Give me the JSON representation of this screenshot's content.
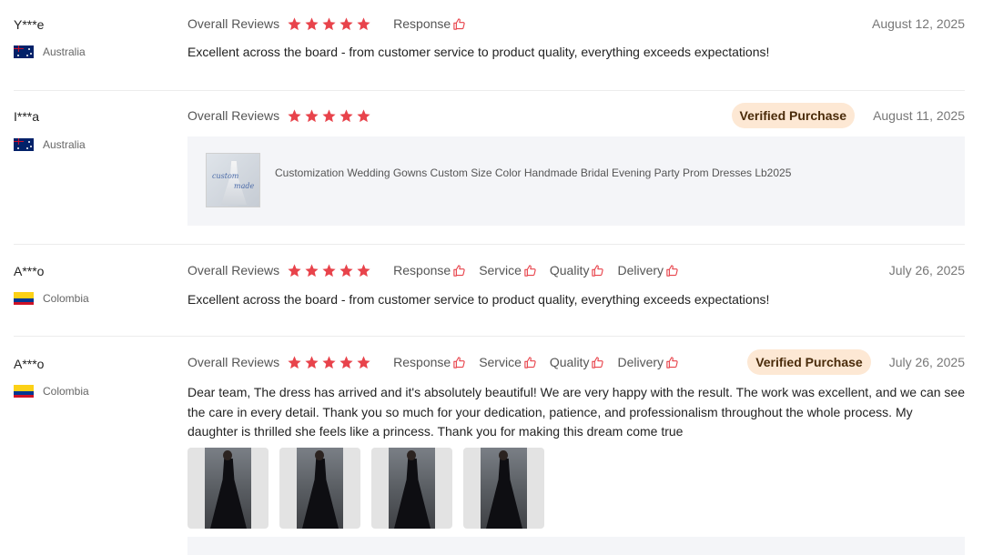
{
  "overall_label": "Overall Reviews",
  "verified_label": "Verified Purchase",
  "metrics": {
    "response": "Response",
    "service": "Service",
    "quality": "Quality",
    "delivery": "Delivery"
  },
  "colors": {
    "star": "#e8434b",
    "thumb": "#e8434b",
    "badge_bg": "#fde8d4"
  },
  "reviews": [
    {
      "user": "Y***e",
      "country": "Australia",
      "rating": 5,
      "date": "August 12, 2025",
      "text": "Excellent across the board - from customer service to product quality, everything exceeds expectations!"
    },
    {
      "user": "I***a",
      "country": "Australia",
      "rating": 5,
      "date": "August 11, 2025",
      "product": {
        "title": "Customization Wedding Gowns Custom Size Color Handmade Bridal Evening Party Prom Dresses Lb2025",
        "thumb_watermark": [
          "custom",
          "made"
        ]
      }
    },
    {
      "user": "A***o",
      "country": "Colombia",
      "rating": 5,
      "date": "July 26, 2025",
      "text": "Excellent across the board - from customer service to product quality, everything exceeds expectations!"
    },
    {
      "user": "A***o",
      "country": "Colombia",
      "rating": 5,
      "date": "July 26, 2025",
      "text": "Dear team, The dress has arrived and it's absolutely beautiful! We are very happy with the result. The work was excellent, and we can see the care in every detail. Thank you so much for your dedication, patience, and professionalism throughout the whole process. My daughter is thrilled she feels like a princess. Thank you for making this dream come true"
    }
  ]
}
